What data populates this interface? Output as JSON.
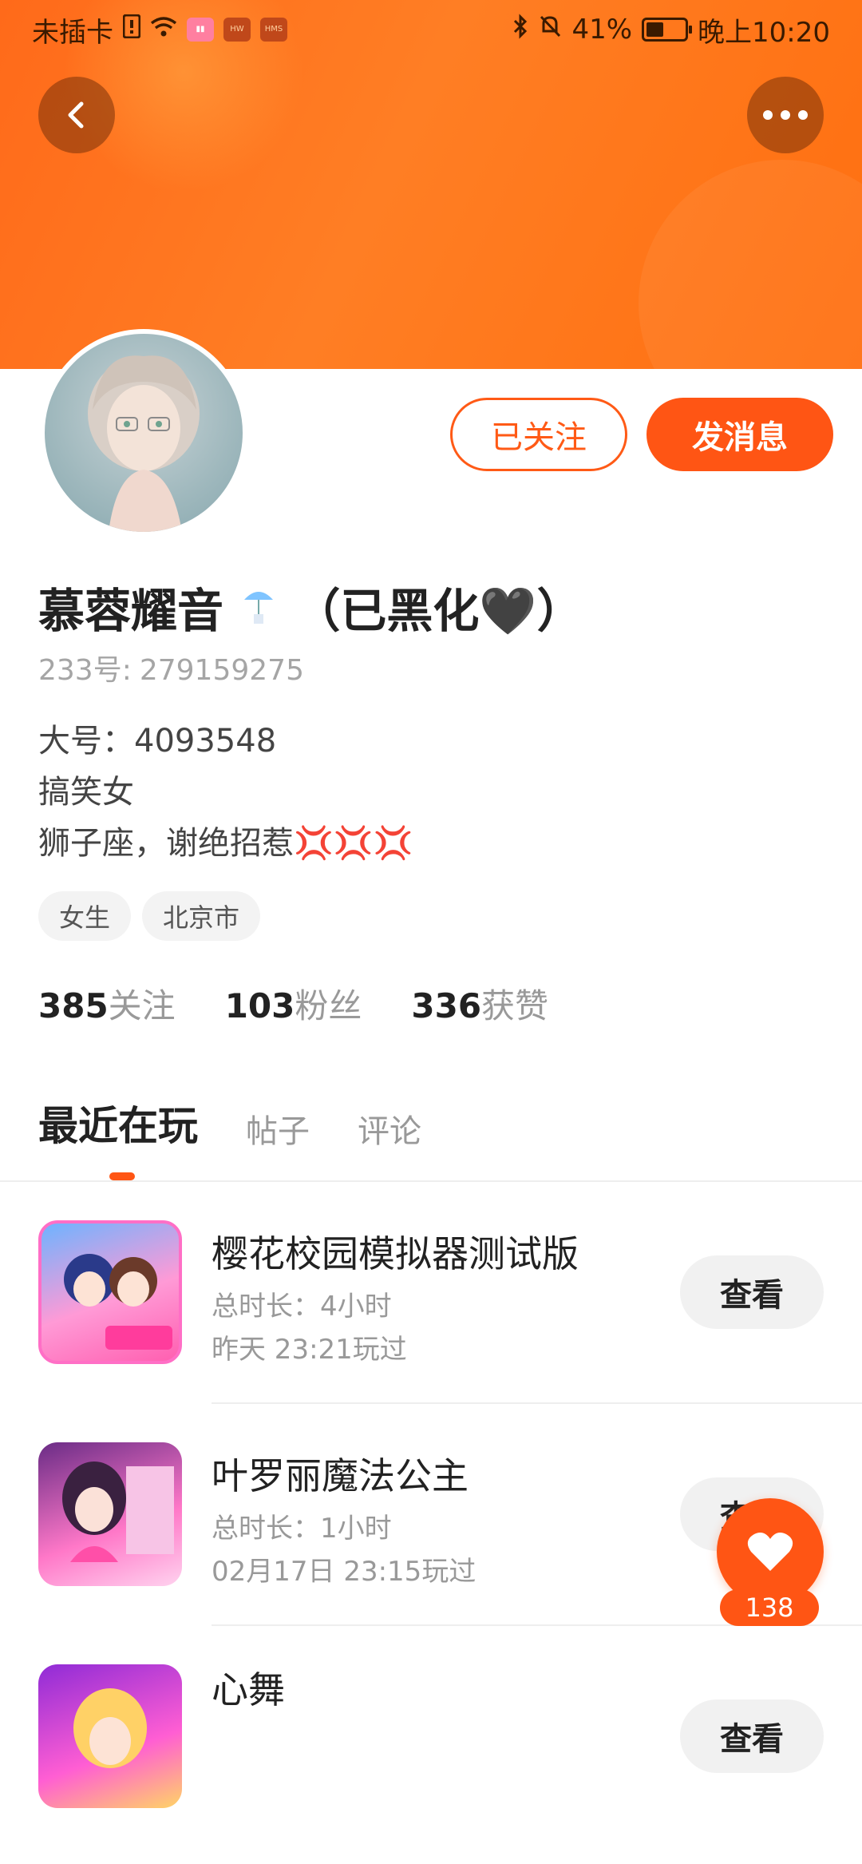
{
  "status_bar": {
    "carrier": "未插卡",
    "battery": "41%",
    "time": "晚上10:20"
  },
  "header": {
    "back_icon": "chevron-left-icon",
    "more_icon": "more-dots-icon"
  },
  "profile": {
    "follow_state_label": "已关注",
    "message_label": "发消息",
    "name": "慕蓉耀音",
    "name_suffix": "（已黑化🖤）",
    "id_label": "233号:",
    "id_value": "279159275",
    "bio": [
      "大号：4093548",
      "搞笑女",
      "狮子座，谢绝招惹"
    ],
    "bio_emoji": "💢💢💢",
    "tags": [
      "女生",
      "北京市"
    ],
    "stats": [
      {
        "num": "385",
        "label": "关注"
      },
      {
        "num": "103",
        "label": "粉丝"
      },
      {
        "num": "336",
        "label": "获赞"
      }
    ]
  },
  "tabs": [
    "最近在玩",
    "帖子",
    "评论"
  ],
  "games": [
    {
      "title": "樱花校园模拟器测试版",
      "duration": "总时长：4小时",
      "last_played": "昨天 23:21玩过",
      "button": "查看"
    },
    {
      "title": "叶罗丽魔法公主",
      "duration": "总时长：1小时",
      "last_played": "02月17日 23:15玩过",
      "button": "查看"
    },
    {
      "title": "心舞",
      "duration": "",
      "last_played": "",
      "button": "查看"
    }
  ],
  "like_fab": {
    "count": "138"
  }
}
